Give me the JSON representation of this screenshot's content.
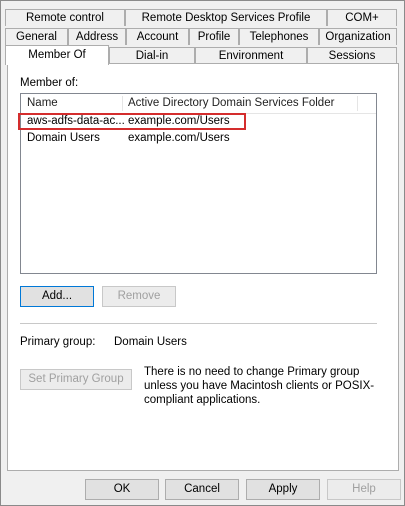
{
  "tabs": {
    "row1": [
      "Remote control",
      "Remote Desktop Services Profile",
      "COM+"
    ],
    "row2": [
      "General",
      "Address",
      "Account",
      "Profile",
      "Telephones",
      "Organization"
    ],
    "row3": [
      "Member Of",
      "Dial-in",
      "Environment",
      "Sessions"
    ],
    "active": "Member Of"
  },
  "member_of": {
    "label": "Member of:",
    "columns": [
      "Name",
      "Active Directory Domain Services Folder"
    ],
    "rows": [
      {
        "name": "aws-adfs-data-ac...",
        "folder": "example.com/Users",
        "highlighted": true
      },
      {
        "name": "Domain Users",
        "folder": "example.com/Users",
        "highlighted": false
      }
    ],
    "highlight_color": "#d42d2d"
  },
  "buttons": {
    "add": "Add...",
    "remove": "Remove",
    "set_primary": "Set Primary Group"
  },
  "primary_group": {
    "label": "Primary group:",
    "value": "Domain Users",
    "note": "There is no need to change Primary group unless you have Macintosh clients or POSIX-compliant applications."
  },
  "footer": {
    "ok": "OK",
    "cancel": "Cancel",
    "apply": "Apply",
    "help": "Help"
  }
}
